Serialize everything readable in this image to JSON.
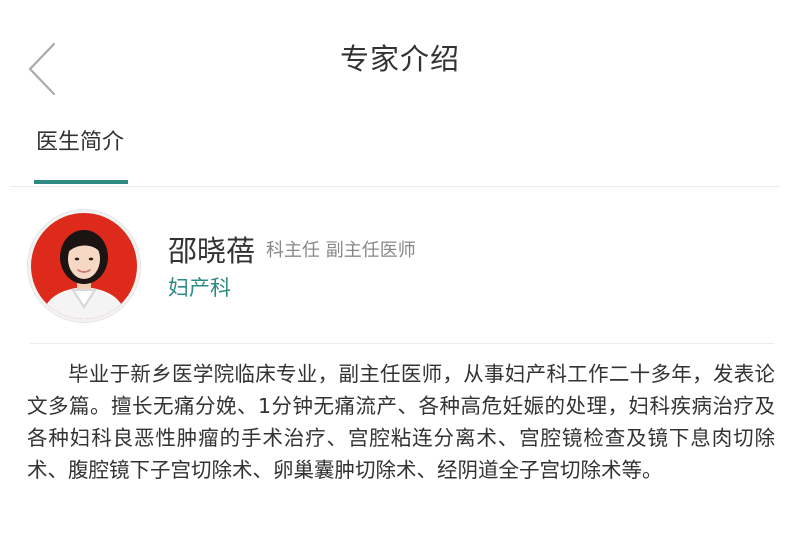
{
  "header": {
    "title": "专家介绍",
    "back_icon": "chevron-left-icon"
  },
  "tabs": [
    {
      "label": "医生简介",
      "active": true
    }
  ],
  "doctor": {
    "name": "邵晓蓓",
    "title": "科主任 副主任医师",
    "department": "妇产科"
  },
  "introduction": "毕业于新乡医学院临床专业，副主任医师，从事妇产科工作二十多年，发表论文多篇。擅长无痛分娩、1分钟无痛流产、各种高危妊娠的处理，妇科疾病治疗及各种妇科良恶性肿瘤的手术治疗、宫腔粘连分离术、宫腔镜检查及镜下息肉切除术、腹腔镜下子宫切除术、卵巢囊肿切除术、经阴道全子宫切除术等。",
  "colors": {
    "accent": "#2e8b84",
    "text": "#333333",
    "secondary_text": "#888888",
    "divider": "#ececec"
  }
}
